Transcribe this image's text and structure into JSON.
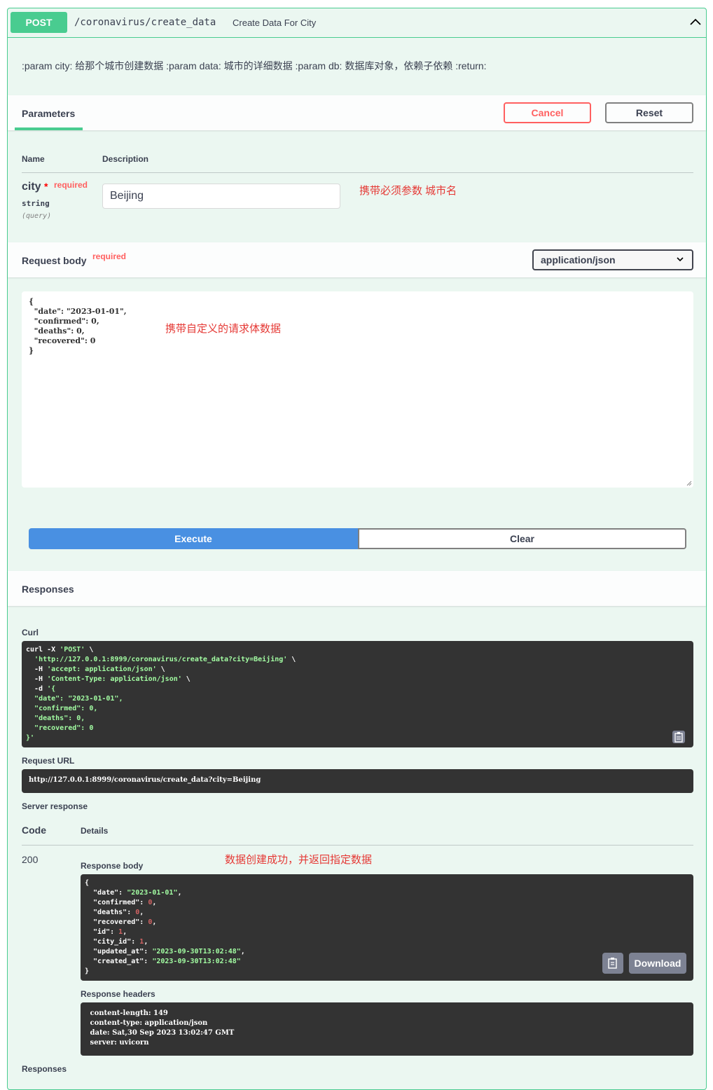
{
  "summary": {
    "method": "POST",
    "path": "/coronavirus/create_data",
    "description": "Create Data For City"
  },
  "description": ":param city: 给那个城市创建数据 :param data: 城市的详细数据 :param db: 数据库对象，依赖子依赖 :return:",
  "parameters": {
    "tab_label": "Parameters",
    "cancel_label": "Cancel",
    "reset_label": "Reset",
    "col_name": "Name",
    "col_description": "Description",
    "param": {
      "name": "city",
      "required_star": "*",
      "required_label": "required",
      "type": "string",
      "in": "(query)",
      "value": "Beijing"
    },
    "note": "携带必须参数 城市名"
  },
  "request_body": {
    "title": "Request body",
    "required_label": "required",
    "content_type": "application/json",
    "lines": [
      "{",
      "  \"date\": \"2023-01-01\",",
      "  \"confirmed\": 0,",
      "  \"deaths\": 0,",
      "  \"recovered\": 0",
      "}"
    ],
    "note": "携带自定义的请求体数据"
  },
  "actions": {
    "execute_label": "Execute",
    "clear_label": "Clear"
  },
  "responses": {
    "title": "Responses",
    "curl_label": "Curl",
    "curl_lines": [
      [
        "curl -X ",
        "'POST'",
        " \\"
      ],
      [
        "  ",
        "'http://127.0.0.1:8999/coronavirus/create_data?city=Beijing'",
        " \\"
      ],
      [
        "  -H ",
        "'accept: application/json'",
        " \\"
      ],
      [
        "  -H ",
        "'Content-Type: application/json'",
        " \\"
      ],
      [
        "  -d ",
        "'{",
        ""
      ],
      [
        "  ",
        "\"date\": \"2023-01-01\",",
        ""
      ],
      [
        "  ",
        "\"confirmed\": 0,",
        ""
      ],
      [
        "  ",
        "\"deaths\": 0,",
        ""
      ],
      [
        "  ",
        "\"recovered\": 0",
        ""
      ],
      [
        "",
        "}'",
        ""
      ]
    ],
    "request_url_label": "Request URL",
    "request_url": "http://127.0.0.1:8999/coronavirus/create_data?city=Beijing",
    "server_response_label": "Server response",
    "col_code": "Code",
    "col_details": "Details",
    "code": "200",
    "note": "数据创建成功，并返回指定数据",
    "response_body_label": "Response body",
    "response_body": [
      {
        "k": "",
        "v": "{",
        "t": "w"
      },
      {
        "k": "  \"date\": ",
        "v": "\"2023-01-01\"",
        "t": "g",
        "s": ","
      },
      {
        "k": "  \"confirmed\": ",
        "v": "0",
        "t": "r",
        "s": ","
      },
      {
        "k": "  \"deaths\": ",
        "v": "0",
        "t": "r",
        "s": ","
      },
      {
        "k": "  \"recovered\": ",
        "v": "0",
        "t": "r",
        "s": ","
      },
      {
        "k": "  \"id\": ",
        "v": "1",
        "t": "r",
        "s": ","
      },
      {
        "k": "  \"city_id\": ",
        "v": "1",
        "t": "r",
        "s": ","
      },
      {
        "k": "  \"updated_at\": ",
        "v": "\"2023-09-30T13:02:48\"",
        "t": "g",
        "s": ","
      },
      {
        "k": "  \"created_at\": ",
        "v": "\"2023-09-30T13:02:48\"",
        "t": "g",
        "s": ""
      },
      {
        "k": "",
        "v": "}",
        "t": "w"
      }
    ],
    "download_label": "Download",
    "response_headers_label": "Response headers",
    "response_headers": [
      " content-length: 149",
      " content-type: application/json",
      " date: Sat,30 Sep 2023 13:02:47 GMT",
      " server: uvicorn"
    ],
    "bottom_label": "Responses"
  }
}
